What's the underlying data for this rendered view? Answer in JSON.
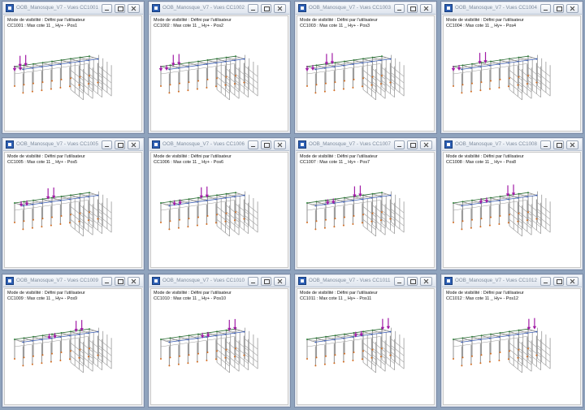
{
  "windows": [
    {
      "title": "OOB_Manosque_V7 - Vues CC1001",
      "visibility": "Mode de visibilité : Défini par l'utilisateur",
      "combo": "CC1001 : Max cote 11 _ Hy+ - Pos1"
    },
    {
      "title": "OOB_Manosque_V7 - Vues CC1002",
      "visibility": "Mode de visibilité : Défini par l'utilisateur",
      "combo": "CC1002 : Max cote 11 _ Hy+ - Pos2"
    },
    {
      "title": "OOB_Manosque_V7 - Vues CC1003",
      "visibility": "Mode de visibilité : Défini par l'utilisateur",
      "combo": "CC1003 : Max cote 11 _ Hy+ - Pos3"
    },
    {
      "title": "OOB_Manosque_V7 - Vues CC1004",
      "visibility": "Mode de visibilité : Défini par l'utilisateur",
      "combo": "CC1004 : Max cote 11 _ Hy+ - Pos4"
    },
    {
      "title": "OOB_Manosque_V7 - Vues CC1005",
      "visibility": "Mode de visibilité : Défini par l'utilisateur",
      "combo": "CC1005 : Max cote 11 _ Hy+ - Pos5"
    },
    {
      "title": "OOB_Manosque_V7 - Vues CC1006",
      "visibility": "Mode de visibilité : Défini par l'utilisateur",
      "combo": "CC1006 : Max cote 11 _ Hy+ - Pos6"
    },
    {
      "title": "OOB_Manosque_V7 - Vues CC1007",
      "visibility": "Mode de visibilité : Défini par l'utilisateur",
      "combo": "CC1007 : Max cote 11 _ Hy+ - Pos7"
    },
    {
      "title": "OOB_Manosque_V7 - Vues CC1008",
      "visibility": "Mode de visibilité : Défini par l'utilisateur",
      "combo": "CC1008 : Max cote 11 _ Hy+ - Pos8"
    },
    {
      "title": "OOB_Manosque_V7 - Vues CC1009",
      "visibility": "Mode de visibilité : Défini par l'utilisateur",
      "combo": "CC1009 : Max cote 11 _ Hy+ - Pos9"
    },
    {
      "title": "OOB_Manosque_V7 - Vues CC1010",
      "visibility": "Mode de visibilité : Défini par l'utilisateur",
      "combo": "CC1010 : Max cote 11 _ Hy+ - Pos10"
    },
    {
      "title": "OOB_Manosque_V7 - Vues CC1011",
      "visibility": "Mode de visibilité : Défini par l'utilisateur",
      "combo": "CC1011 : Max cote 11 _ Hy+ - Pos11"
    },
    {
      "title": "OOB_Manosque_V7 - Vues CC1012",
      "visibility": "Mode de visibilité : Défini par l'utilisateur",
      "combo": "CC1012 : Max cote 11 _ Hy+ - Pos12"
    }
  ],
  "icons": {
    "app": "app-icon",
    "minimize": "minimize-icon",
    "maximize": "maximize-icon",
    "close": "close-icon",
    "load": "downward-load-arrow-icon"
  },
  "colors": {
    "desktop": "#8fa3bd",
    "frame": "#9a9a9a",
    "load_arrow": "#a11ba6",
    "node_orange": "#d26b1f",
    "node_green": "#2f8a3c",
    "node_blue": "#3b5db3"
  }
}
